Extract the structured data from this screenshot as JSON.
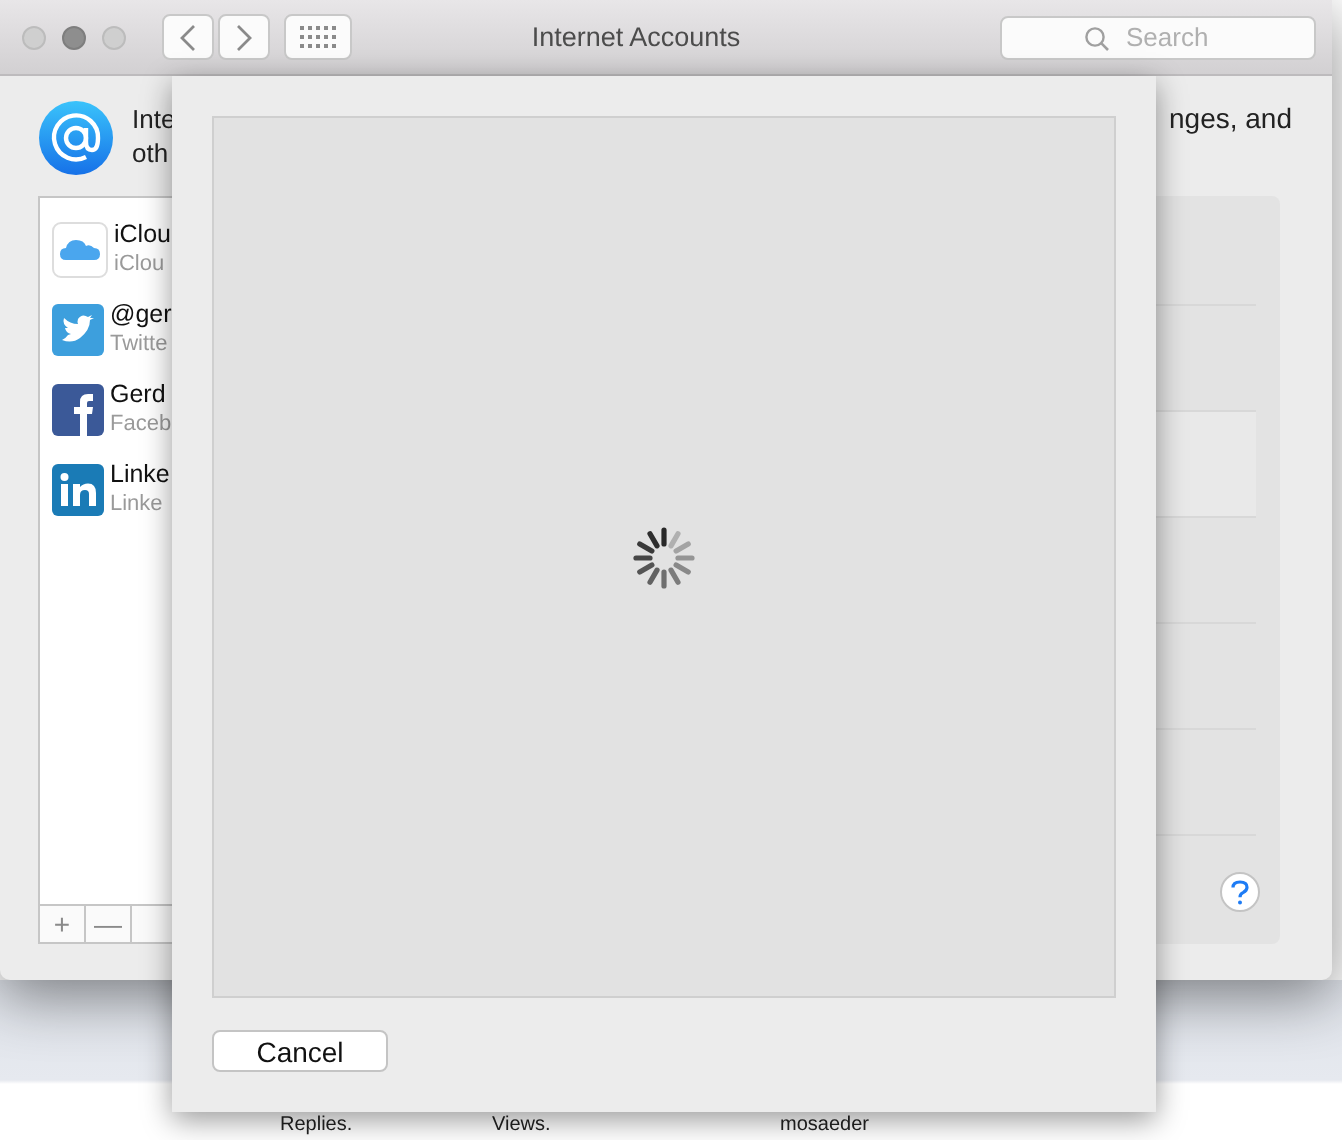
{
  "window": {
    "title": "Internet Accounts"
  },
  "search": {
    "placeholder": "Search"
  },
  "intro": {
    "left_lines": [
      "Inte",
      "oth"
    ],
    "right_text": "nges, and"
  },
  "accounts": [
    {
      "kind": "icloud",
      "name": "iClou",
      "detail": "iClou"
    },
    {
      "kind": "twitter",
      "name": "@ger",
      "detail": "Twitte"
    },
    {
      "kind": "facebook",
      "name": "Gerd",
      "detail": "Faceb"
    },
    {
      "kind": "linkedin",
      "name": "Linke",
      "detail": "Linke"
    }
  ],
  "list_buttons": [
    "+",
    "—"
  ],
  "sheet": {
    "button": "Cancel"
  },
  "background_page": [
    "Replies.",
    "Views.",
    "mosaeder"
  ]
}
